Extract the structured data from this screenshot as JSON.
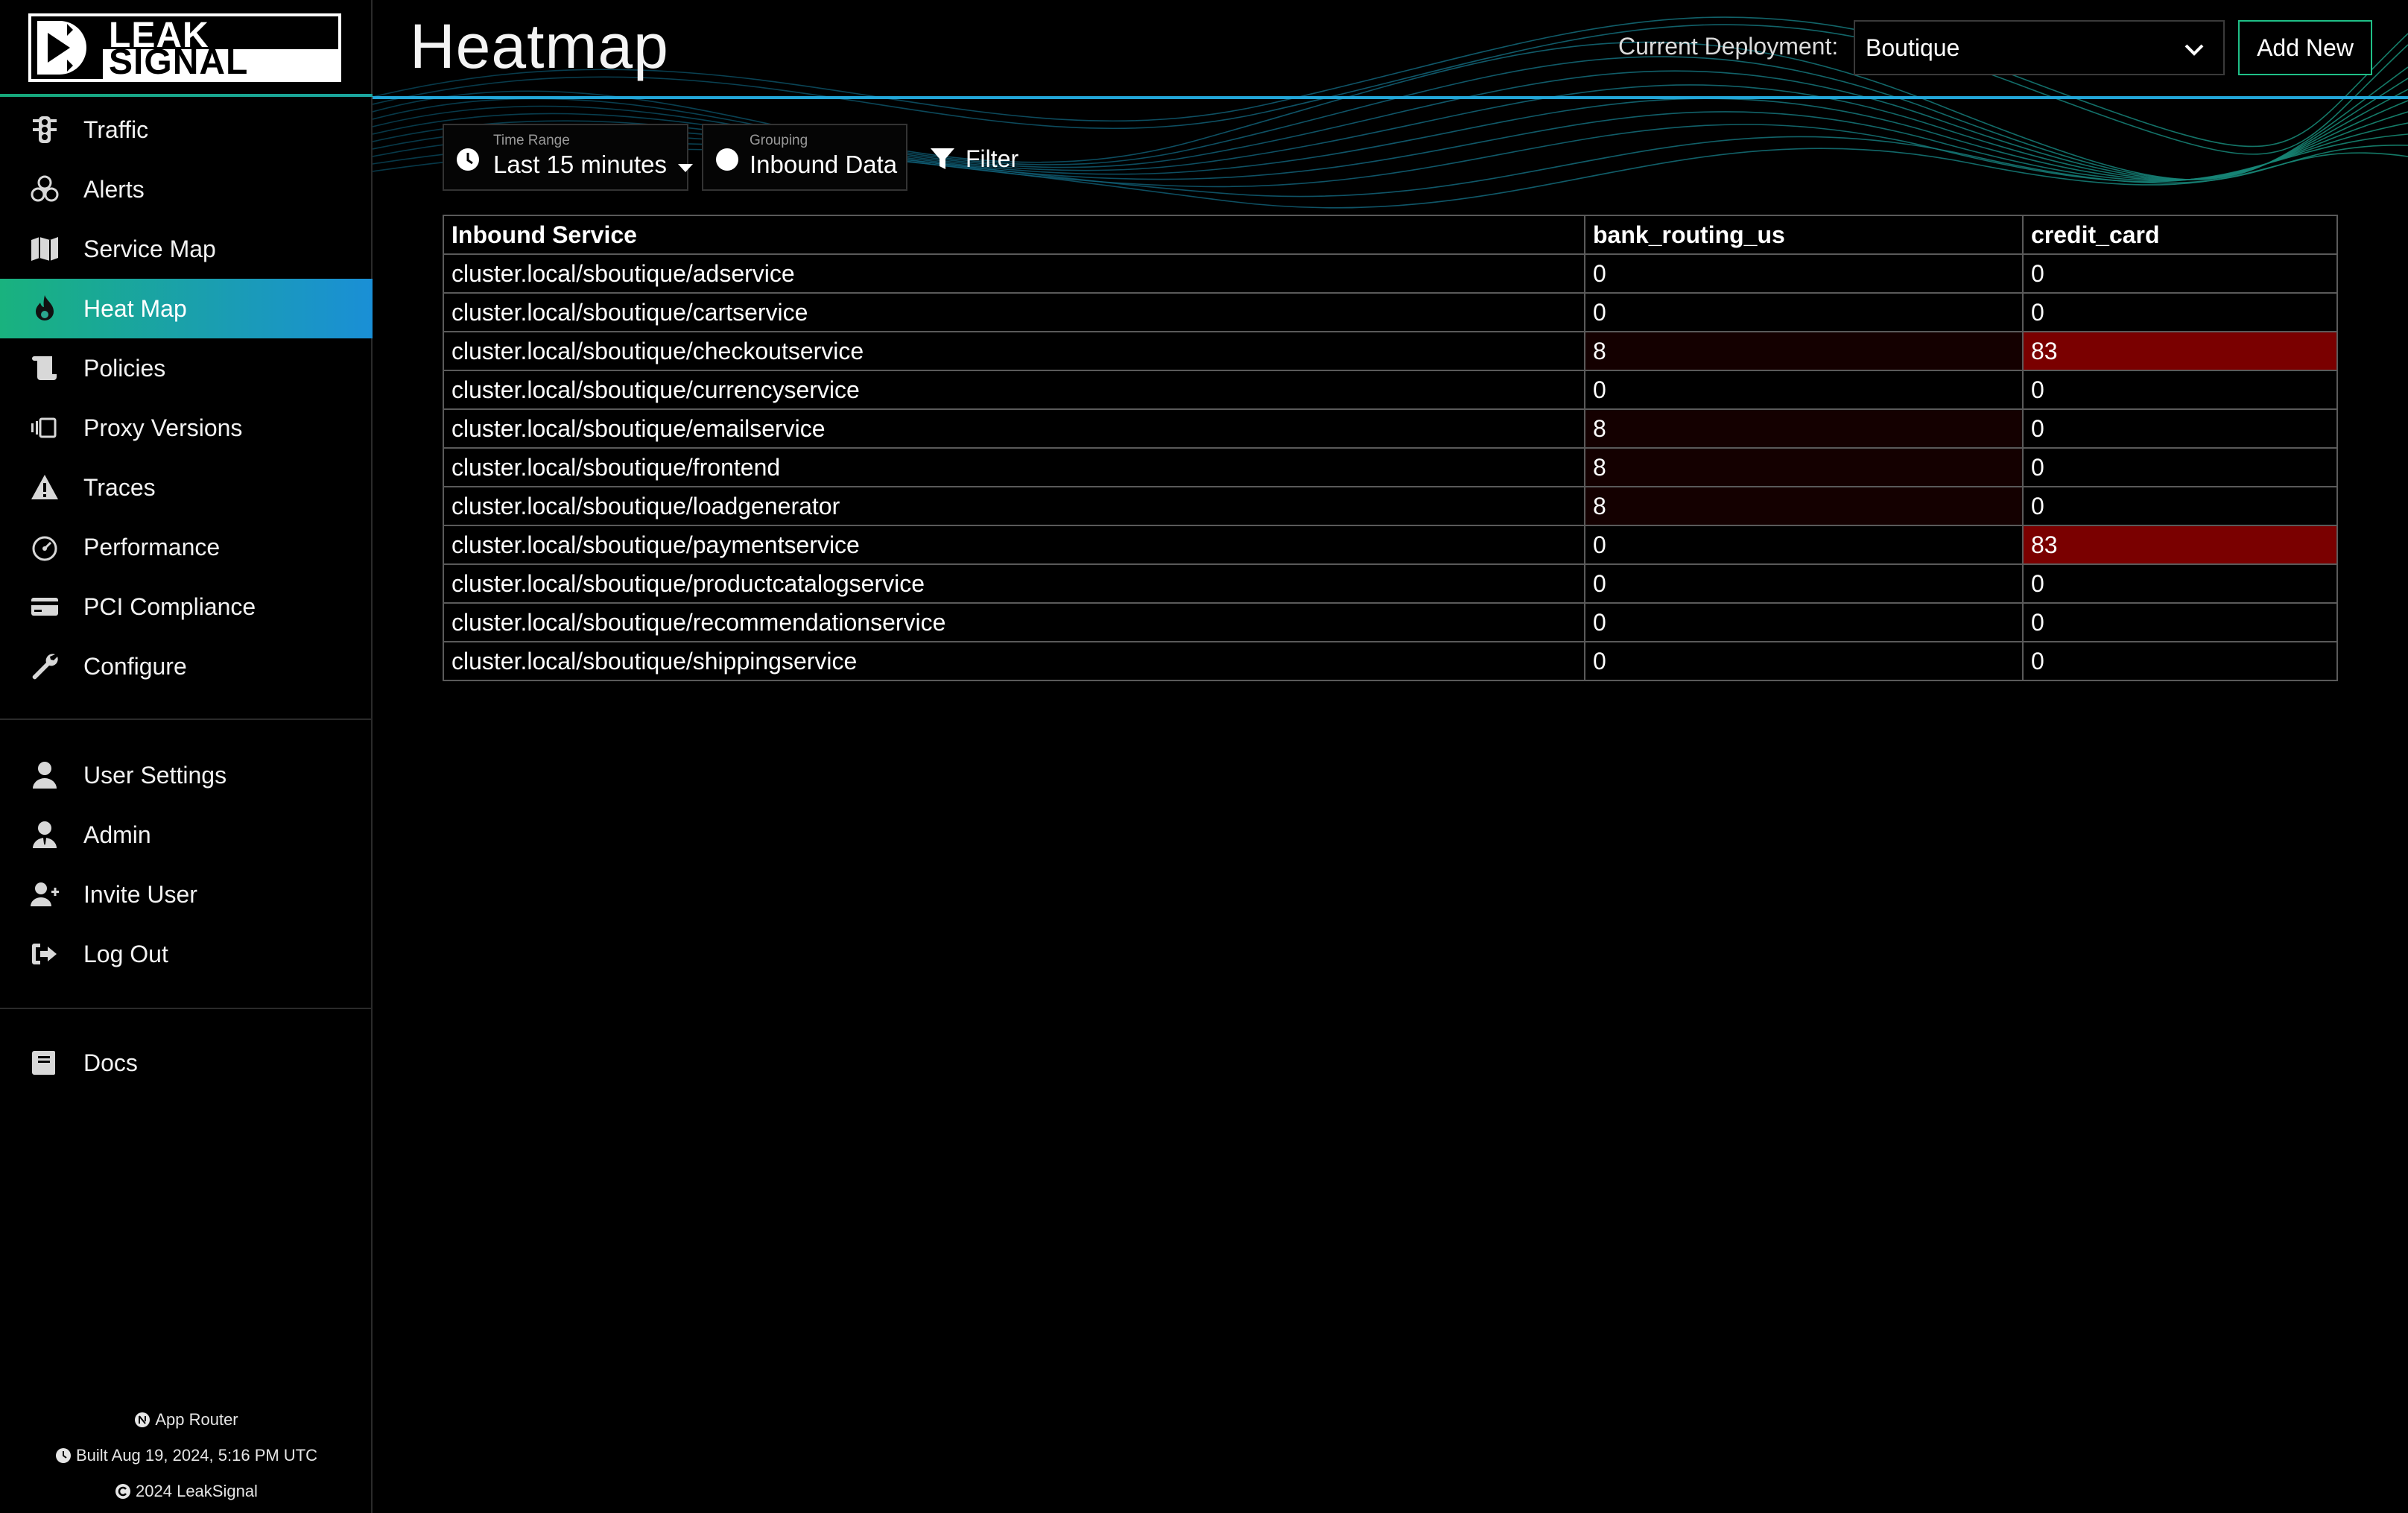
{
  "logo": {
    "line1": "LEAK",
    "line2": "SIGNAL"
  },
  "sidebar": {
    "primary": [
      {
        "label": "Traffic",
        "icon": "traffic-light-icon",
        "active": false
      },
      {
        "label": "Alerts",
        "icon": "biohazard-icon",
        "active": false
      },
      {
        "label": "Service Map",
        "icon": "map-icon",
        "active": false
      },
      {
        "label": "Heat Map",
        "icon": "fire-icon",
        "active": true
      },
      {
        "label": "Policies",
        "icon": "scroll-icon",
        "active": false
      },
      {
        "label": "Proxy Versions",
        "icon": "versions-icon",
        "active": false
      },
      {
        "label": "Traces",
        "icon": "warning-triangle-icon",
        "active": false
      },
      {
        "label": "Performance",
        "icon": "gauge-icon",
        "active": false
      },
      {
        "label": "PCI Compliance",
        "icon": "credit-card-icon",
        "active": false
      },
      {
        "label": "Configure",
        "icon": "wrench-icon",
        "active": false
      }
    ],
    "account": [
      {
        "label": "User Settings",
        "icon": "user-icon"
      },
      {
        "label": "Admin",
        "icon": "user-tie-icon"
      },
      {
        "label": "Invite User",
        "icon": "user-plus-icon"
      },
      {
        "label": "Log Out",
        "icon": "sign-out-icon"
      }
    ],
    "docs": [
      {
        "label": "Docs",
        "icon": "book-icon"
      }
    ],
    "footer": {
      "router": "App Router",
      "built": "Built Aug 19, 2024, 5:16 PM UTC",
      "copyright": "2024 LeakSignal"
    }
  },
  "header": {
    "title": "Heatmap",
    "deployment_label": "Current Deployment:",
    "deployment_value": "Boutique",
    "add_new": "Add New"
  },
  "toolbar": {
    "time_range_label": "Time Range",
    "time_range_value": "Last 15 minutes",
    "grouping_label": "Grouping",
    "grouping_value": "Inbound Data",
    "filter_label": "Filter"
  },
  "colors": {
    "accent_green": "#1fbf87",
    "accent_blue": "#1a8fd6",
    "heat_high": "#7a0000",
    "heat_low": "#140000"
  },
  "table": {
    "columns": [
      "Inbound Service",
      "bank_routing_us",
      "credit_card"
    ],
    "rows": [
      {
        "service": "cluster.local/sboutique/adservice",
        "bank_routing_us": "0",
        "credit_card": "0"
      },
      {
        "service": "cluster.local/sboutique/cartservice",
        "bank_routing_us": "0",
        "credit_card": "0"
      },
      {
        "service": "cluster.local/sboutique/checkoutservice",
        "bank_routing_us": "8",
        "credit_card": "83"
      },
      {
        "service": "cluster.local/sboutique/currencyservice",
        "bank_routing_us": "0",
        "credit_card": "0"
      },
      {
        "service": "cluster.local/sboutique/emailservice",
        "bank_routing_us": "8",
        "credit_card": "0"
      },
      {
        "service": "cluster.local/sboutique/frontend",
        "bank_routing_us": "8",
        "credit_card": "0"
      },
      {
        "service": "cluster.local/sboutique/loadgenerator",
        "bank_routing_us": "8",
        "credit_card": "0"
      },
      {
        "service": "cluster.local/sboutique/paymentservice",
        "bank_routing_us": "0",
        "credit_card": "83"
      },
      {
        "service": "cluster.local/sboutique/productcatalogservice",
        "bank_routing_us": "0",
        "credit_card": "0"
      },
      {
        "service": "cluster.local/sboutique/recommendationservice",
        "bank_routing_us": "0",
        "credit_card": "0"
      },
      {
        "service": "cluster.local/sboutique/shippingservice",
        "bank_routing_us": "0",
        "credit_card": "0"
      }
    ]
  }
}
